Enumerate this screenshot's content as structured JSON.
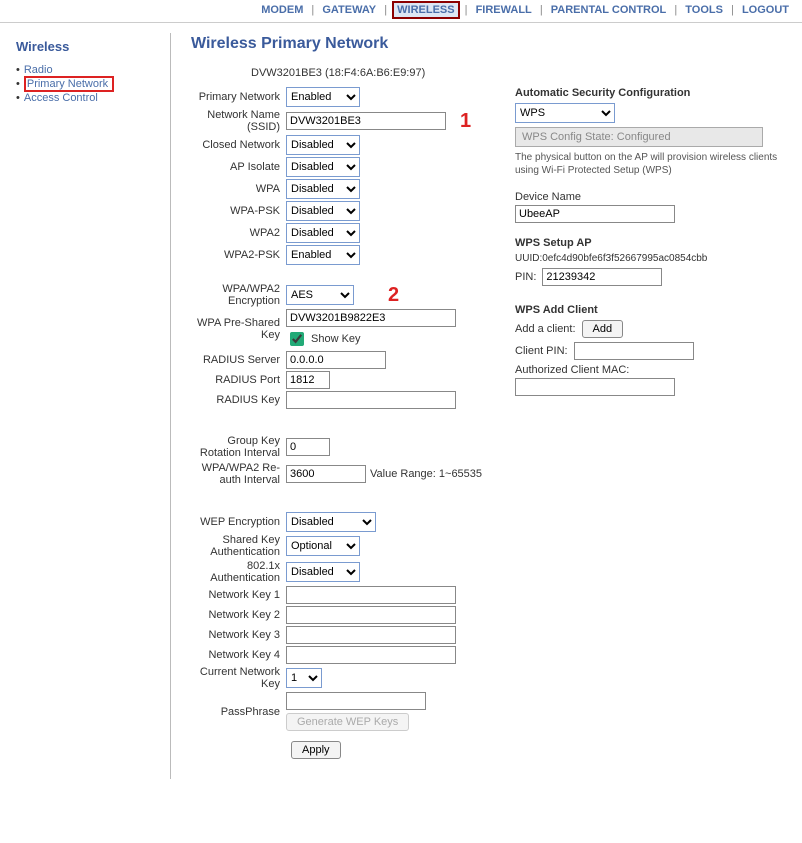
{
  "topnav": {
    "items": [
      "MODEM",
      "GATEWAY",
      "WIRELESS",
      "FIREWALL",
      "PARENTAL CONTROL",
      "TOOLS",
      "LOGOUT"
    ],
    "active_index": 2
  },
  "sidebar": {
    "title": "Wireless",
    "items": [
      "Radio",
      "Primary Network",
      "Access Control"
    ],
    "selected_index": 1
  },
  "page_title": "Wireless Primary Network",
  "mac_line": "DVW3201BE3 (18:F4:6A:B6:E9:97)",
  "annotations": {
    "one": "1",
    "two": "2"
  },
  "left": {
    "primary_network": {
      "label": "Primary Network",
      "value": "Enabled"
    },
    "ssid": {
      "label": "Network Name (SSID)",
      "value": "DVW3201BE3"
    },
    "closed_network": {
      "label": "Closed Network",
      "value": "Disabled"
    },
    "ap_isolate": {
      "label": "AP Isolate",
      "value": "Disabled"
    },
    "wpa": {
      "label": "WPA",
      "value": "Disabled"
    },
    "wpa_psk": {
      "label": "WPA-PSK",
      "value": "Disabled"
    },
    "wpa2": {
      "label": "WPA2",
      "value": "Disabled"
    },
    "wpa2_psk": {
      "label": "WPA2-PSK",
      "value": "Enabled"
    },
    "encryption": {
      "label": "WPA/WPA2 Encryption",
      "value": "AES"
    },
    "psk": {
      "label": "WPA Pre-Shared Key",
      "value": "DVW3201B9822E3",
      "show_key_label": "Show Key",
      "show_key_checked": true
    },
    "radius_server": {
      "label": "RADIUS Server",
      "value": "0.0.0.0"
    },
    "radius_port": {
      "label": "RADIUS Port",
      "value": "1812"
    },
    "radius_key": {
      "label": "RADIUS Key",
      "value": ""
    },
    "group_key": {
      "label": "Group Key Rotation Interval",
      "value": "0"
    },
    "reauth": {
      "label": "WPA/WPA2 Re-auth Interval",
      "value": "3600",
      "hint": "Value Range: 1~65535"
    },
    "wep": {
      "label": "WEP Encryption",
      "value": "Disabled"
    },
    "shared_key_auth": {
      "label": "Shared Key Authentication",
      "value": "Optional"
    },
    "dot1x": {
      "label": "802.1x Authentication",
      "value": "Disabled"
    },
    "nk1": {
      "label": "Network Key 1",
      "value": ""
    },
    "nk2": {
      "label": "Network Key 2",
      "value": ""
    },
    "nk3": {
      "label": "Network Key 3",
      "value": ""
    },
    "nk4": {
      "label": "Network Key 4",
      "value": ""
    },
    "current_key": {
      "label": "Current Network Key",
      "value": "1"
    },
    "passphrase": {
      "label": "PassPhrase",
      "value": "",
      "gen_btn": "Generate WEP Keys"
    },
    "apply_btn": "Apply"
  },
  "right": {
    "auto_sec": {
      "title": "Automatic Security Configuration",
      "value": "WPS"
    },
    "wps_state": "WPS Config State: Configured",
    "note": "The physical button on the AP will provision wireless clients using Wi-Fi Protected Setup (WPS)",
    "device_name": {
      "label": "Device Name",
      "value": "UbeeAP"
    },
    "wps_setup": {
      "title": "WPS Setup AP",
      "uuid": "UUID:0efc4d90bfe6f3f52667995ac0854cbb",
      "pin_label": "PIN:",
      "pin_value": "21239342"
    },
    "wps_add": {
      "title": "WPS Add Client",
      "add_label": "Add a client:",
      "add_btn": "Add",
      "client_pin_label": "Client PIN:",
      "client_pin_value": "",
      "auth_mac_label": "Authorized Client MAC:",
      "auth_mac_value": ""
    }
  }
}
